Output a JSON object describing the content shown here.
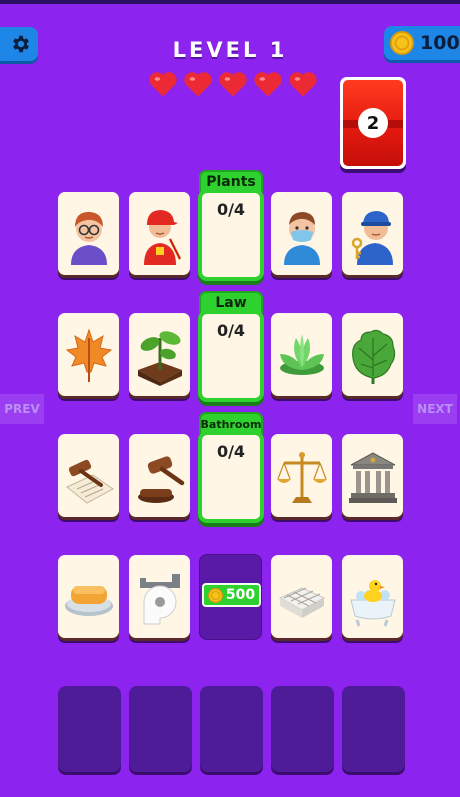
{
  "header": {
    "level_title": "LEVEL 1",
    "coins": "100",
    "lives": 5,
    "moves_left": "2"
  },
  "nav": {
    "prev_label": "PREV",
    "next_label": "NEXT"
  },
  "categories": [
    {
      "name": "Plants",
      "count": "0/4"
    },
    {
      "name": "Law",
      "count": "0/4"
    },
    {
      "name": "Bathroom",
      "count": "0/4"
    }
  ],
  "rows": [
    [
      "boy-with-glasses",
      "firefighter-boy",
      "category-slot",
      "boy-with-mask",
      "locksmith-boy"
    ],
    [
      "maple-leaf",
      "potted-seedling",
      "category-slot",
      "green-succulent",
      "fig-leaf"
    ],
    [
      "gavel-on-document",
      "judge-gavel",
      "category-slot",
      "scales-of-justice",
      "courthouse"
    ],
    [
      "soap-bar",
      "toilet-paper-roll",
      "locked-slot",
      "folded-towel",
      "rubber-duck-bathtub"
    ]
  ],
  "locked_slot": {
    "price": "500"
  },
  "colors": {
    "background": "#8d23ee",
    "accent_green": "#2ed12e",
    "button_blue": "#1e86e6",
    "heart_red": "#ec2a36"
  }
}
